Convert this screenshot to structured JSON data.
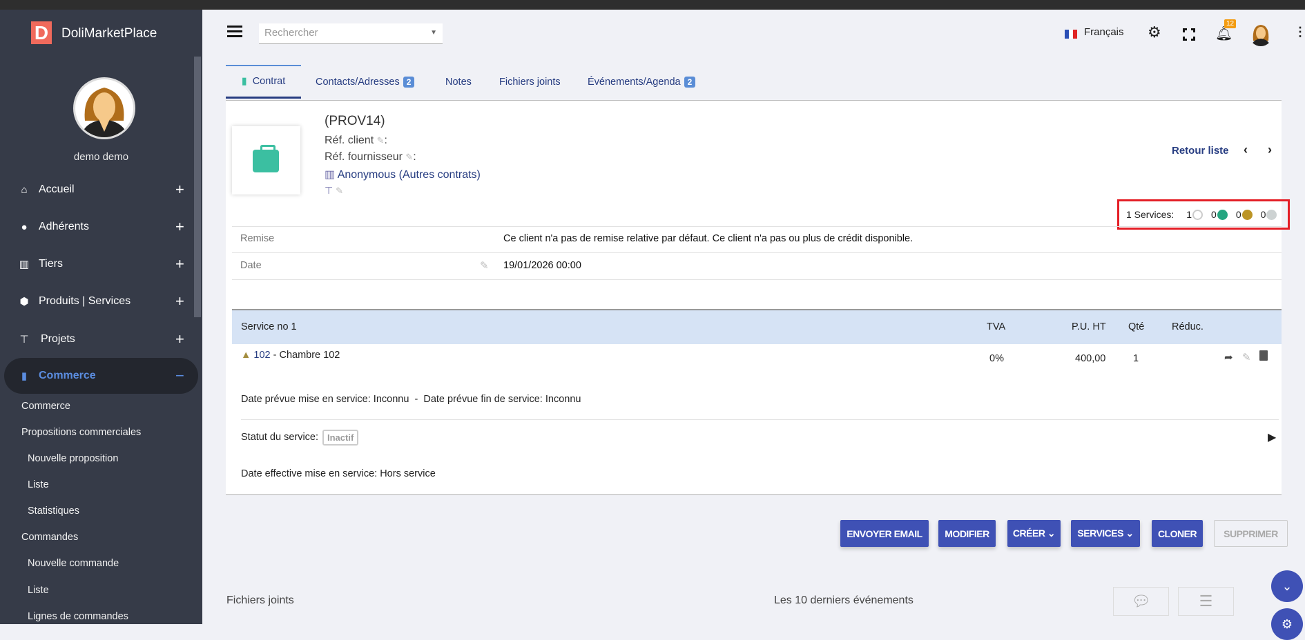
{
  "sidebar": {
    "brand": "DoliMarketPlace",
    "logo_letter": "D",
    "user": "demo demo",
    "menu": [
      {
        "label": "Accueil",
        "icon": "home-icon"
      },
      {
        "label": "Adhérents",
        "icon": "user-icon"
      },
      {
        "label": "Tiers",
        "icon": "building-icon"
      },
      {
        "label": "Produits | Services",
        "icon": "cube-icon"
      },
      {
        "label": "Projets",
        "icon": "sitemap-icon"
      }
    ],
    "active": {
      "label": "Commerce",
      "toggle": "−"
    },
    "sub": [
      "Commerce",
      "Propositions commerciales",
      "Nouvelle proposition",
      "Liste",
      "Statistiques",
      "Commandes",
      "Nouvelle commande",
      "Liste",
      "Lignes de commandes"
    ]
  },
  "topbar": {
    "search_placeholder": "Rechercher",
    "language": "Français",
    "notifications": "12"
  },
  "tabs": [
    {
      "label": "Contrat"
    },
    {
      "label": "Contacts/Adresses",
      "badge": "2"
    },
    {
      "label": "Notes"
    },
    {
      "label": "Fichiers joints"
    },
    {
      "label": "Événements/Agenda",
      "badge": "2"
    }
  ],
  "header": {
    "ref": "(PROV14)",
    "ref_client": "Réf. client",
    "ref_supplier": "Réf. fournisseur",
    "colon": ":",
    "thirdparty": "Anonymous (Autres contrats)",
    "back": "Retour liste",
    "services_summary": {
      "label": "1 Services:",
      "counts": [
        "1",
        "0",
        "0",
        "0"
      ],
      "colors": [
        "#ffffff",
        "#25a580",
        "#bc9526",
        "#cdd2d2"
      ]
    }
  },
  "fields": [
    {
      "label": "Remise",
      "value": "Ce client n'a pas de remise relative par défaut. Ce client n'a pas ou plus de crédit disponible."
    },
    {
      "label": "Date",
      "value": "19/01/2026 00:00"
    }
  ],
  "table": {
    "headers": {
      "service": "Service no 1",
      "tva": "TVA",
      "pu": "P.U. HT",
      "qty": "Qté",
      "disc": "Réduc."
    },
    "line": {
      "ref": "102",
      "desc": " - Chambre 102",
      "tva": "0%",
      "pu": "400,00",
      "qty": "1"
    },
    "planned": "Date prévue mise en service: Inconnu  -  Date prévue fin de service: Inconnu",
    "status_label": "Statut du service:",
    "status": "Inactif",
    "effective": "Date effective mise en service: Hors service"
  },
  "actions": [
    "ENVOYER EMAIL",
    "MODIFIER",
    "CRÉER ⌄",
    "SERVICES ⌄",
    "CLONER",
    "SUPPRIMER"
  ],
  "footer": {
    "files": "Fichiers joints",
    "events": "Les 10 derniers événements"
  }
}
